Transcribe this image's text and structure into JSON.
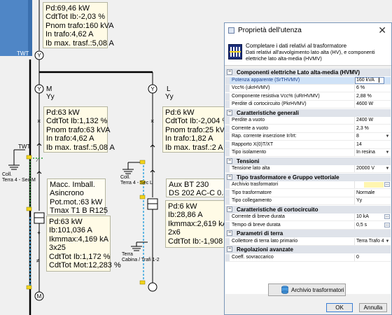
{
  "diagram": {
    "top_box": [
      "Pd:69,46 kW",
      "CdtTot Ib:-2,03 %",
      "Pnom trafo:160 kVA",
      "In trafo:4,62 A",
      "Ib max. trasf.:5,08 A"
    ],
    "twt_top_label": "TWT",
    "left_branch": {
      "tag": "M",
      "sub": "Yy",
      "info": [
        "Pd:63 kW",
        "CdtTot Ib:1,132 %",
        "Pnom trafo:63 kVA",
        "In trafo:4,62 A",
        "Ib max. trasf.:5,08 A"
      ],
      "twt_label": "TWT",
      "earth_label": "Coll.\nTerra 4 - Sec M",
      "motor_box": [
        "Macc. Imball.",
        "Asincrono",
        "Pot.mot.:63 kW",
        "Tmax T1 B R125"
      ],
      "load_box": [
        "Pd:63 kW",
        "Ib:101,036 A",
        "Ikmmax:4,169 kA",
        "3x25",
        "CdtTot Ib:1,172 %",
        "CdtTot Mot:12,283 %"
      ]
    },
    "right_branch": {
      "tag": "L",
      "sub": "Yy",
      "info": [
        "Pd:6 kW",
        "CdtTot Ib:-2,004 %",
        "Pnom trafo:25 kVA",
        "In trafo:1,82 A",
        "Ib max. trasf.:2 A"
      ],
      "earth_label": "Coll.\nTerra 4 - Sec L",
      "aux_box": [
        "Aux BT 230",
        "DS 202 AC-C 0.3"
      ],
      "load_box": [
        "Pd:6 kW",
        "Ib:28,86 A",
        "Ikmmax:2,619 kA",
        "2x6",
        "CdtTot Ib:-1,908 %"
      ],
      "cabin_label": "Terra\nCabina / Trafi 1-2"
    }
  },
  "dialog": {
    "title": "Proprietà dell'utenza",
    "close_glyph": "✕",
    "header_title": "Completare i dati relativi al trasformatore",
    "header_desc": "Dati relativi all'avvolgimento lato alta (HV), e componenti elettriche lato alta-media (HVMV)",
    "sections": [
      {
        "title": "Componenti elettriche Lato alta-media (HVMV)",
        "rows": [
          {
            "name": "Potenza apparente (SrTHVMV)",
            "value": "160 kVA",
            "kind": "edit",
            "selected": true
          },
          {
            "name": "Vcc% (ukrHVMV)",
            "value": "6 %"
          },
          {
            "name": "Componente resistiva Vcc% (uRrHVMV)",
            "value": "2,88 %"
          },
          {
            "name": "Perdite di cortocircuito (PkrHVMV)",
            "value": "4600 W"
          }
        ]
      },
      {
        "title": "Caratteristiche generali",
        "rows": [
          {
            "name": "Perdite a vuoto",
            "value": "2400 W"
          },
          {
            "name": "Corrente a vuoto",
            "value": "2,3 %"
          },
          {
            "name": "Rap. corrente inserzione Ir/Irt:",
            "value": "8",
            "kind": "dropdown"
          },
          {
            "name": "Rapporto X(0)T/XT",
            "value": "14"
          },
          {
            "name": "Tipo isolamento",
            "value": "In resina",
            "kind": "dropdown"
          }
        ]
      },
      {
        "title": "Tensioni",
        "rows": [
          {
            "name": "Tensione lato alta",
            "value": "20000 V",
            "kind": "dropdown"
          }
        ]
      },
      {
        "title": "Tipo trasformatore e Gruppo vettoriale",
        "rows": [
          {
            "name": "Archivio trasformatori",
            "value": "",
            "kind": "ellipsis-yellow"
          },
          {
            "name": "Tipo trasformatore",
            "value": "Normale"
          },
          {
            "name": "Tipo collegamento",
            "value": "Yy"
          }
        ]
      },
      {
        "title": "Caratteristiche di cortocircuito",
        "rows": [
          {
            "name": "Corrente di breve durata",
            "value": "10 kA",
            "kind": "ellipsis"
          },
          {
            "name": "Tempo di breve durata",
            "value": "0,5 s",
            "kind": "ellipsis"
          }
        ]
      },
      {
        "title": "Parametri di terra",
        "rows": [
          {
            "name": "Collettore di terra lato primario",
            "value": "Terra Trafo 4",
            "kind": "dropdown"
          }
        ]
      },
      {
        "title": "Regolazioni avanzate",
        "rows": [
          {
            "name": "Coeff. sovraccarico",
            "value": "0"
          }
        ]
      }
    ],
    "archive_button": "Archivio trasformatori",
    "ok_button": "OK",
    "cancel_button": "Annulla"
  }
}
